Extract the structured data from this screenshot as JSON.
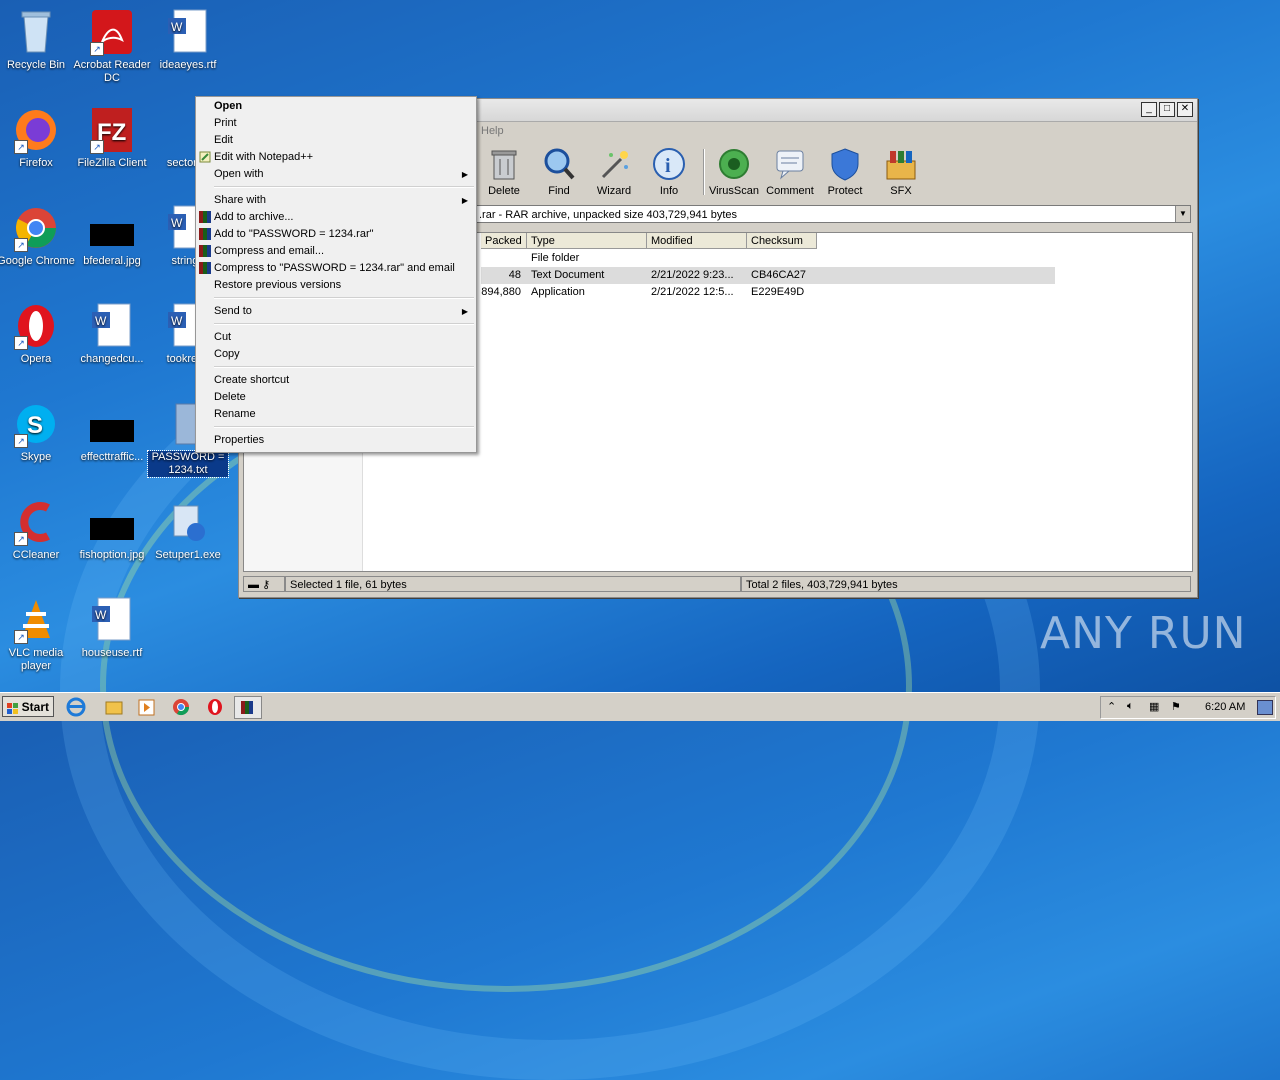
{
  "desktop": {
    "icons": [
      {
        "label": "Recycle Bin"
      },
      {
        "label": "Acrobat Reader DC"
      },
      {
        "label": "ideaeyes.rtf"
      },
      {
        "label": "Firefox"
      },
      {
        "label": "FileZilla Client"
      },
      {
        "label": "sectorou"
      },
      {
        "label": "Google Chrome"
      },
      {
        "label": "bfederal.jpg"
      },
      {
        "label": "stringd"
      },
      {
        "label": "Opera"
      },
      {
        "label": "changedcu..."
      },
      {
        "label": "tookrega"
      },
      {
        "label": "Skype"
      },
      {
        "label": "effecttraffic..."
      },
      {
        "label": "PASSWORD = 1234.txt"
      },
      {
        "label": "CCleaner"
      },
      {
        "label": "fishoption.jpg"
      },
      {
        "label": "Setuper1.exe"
      },
      {
        "label": "VLC media player"
      },
      {
        "label": "houseuse.rtf"
      }
    ]
  },
  "winrar": {
    "menu_visible": "Help",
    "toolbar": [
      {
        "label": "Delete",
        "icon": "trash-icon"
      },
      {
        "label": "Find",
        "icon": "magnifier-icon"
      },
      {
        "label": "Wizard",
        "icon": "wand-icon"
      },
      {
        "label": "Info",
        "icon": "info-icon"
      },
      {
        "label": "VirusScan",
        "icon": "bug-icon"
      },
      {
        "label": "Comment",
        "icon": "comment-icon"
      },
      {
        "label": "Protect",
        "icon": "shield-icon"
      },
      {
        "label": "SFX",
        "icon": "sfx-icon"
      }
    ],
    "path": ".rar - RAR archive, unpacked size 403,729,941 bytes",
    "columns": [
      "Packed",
      "Type",
      "Modified",
      "Checksum"
    ],
    "rows": [
      {
        "packed": "",
        "type": "File folder",
        "modified": "",
        "checksum": ""
      },
      {
        "packed": "48",
        "type": "Text Document",
        "modified": "2/21/2022 9:23...",
        "checksum": "CB46CA27"
      },
      {
        "packed": "894,880",
        "type": "Application",
        "modified": "2/21/2022 12:5...",
        "checksum": "E229E49D"
      }
    ],
    "status_left": "Selected 1 file, 61 bytes",
    "status_right": "Total 2 files, 403,729,941 bytes"
  },
  "context_menu": {
    "items": [
      {
        "label": "Open"
      },
      {
        "label": "Print"
      },
      {
        "label": "Edit"
      },
      {
        "label": "Edit with Notepad++"
      },
      {
        "label": "Open with"
      },
      {
        "label": "Share with"
      },
      {
        "label": "Add to archive..."
      },
      {
        "label": "Add to \"PASSWORD  =  1234.rar\""
      },
      {
        "label": "Compress and email..."
      },
      {
        "label": "Compress to \"PASSWORD  =  1234.rar\" and email"
      },
      {
        "label": "Restore previous versions"
      },
      {
        "label": "Send to"
      },
      {
        "label": "Cut"
      },
      {
        "label": "Copy"
      },
      {
        "label": "Create shortcut"
      },
      {
        "label": "Delete"
      },
      {
        "label": "Rename"
      },
      {
        "label": "Properties"
      }
    ]
  },
  "taskbar": {
    "start_label": "Start",
    "clock": "6:20 AM"
  },
  "watermark": "ANY RUN"
}
